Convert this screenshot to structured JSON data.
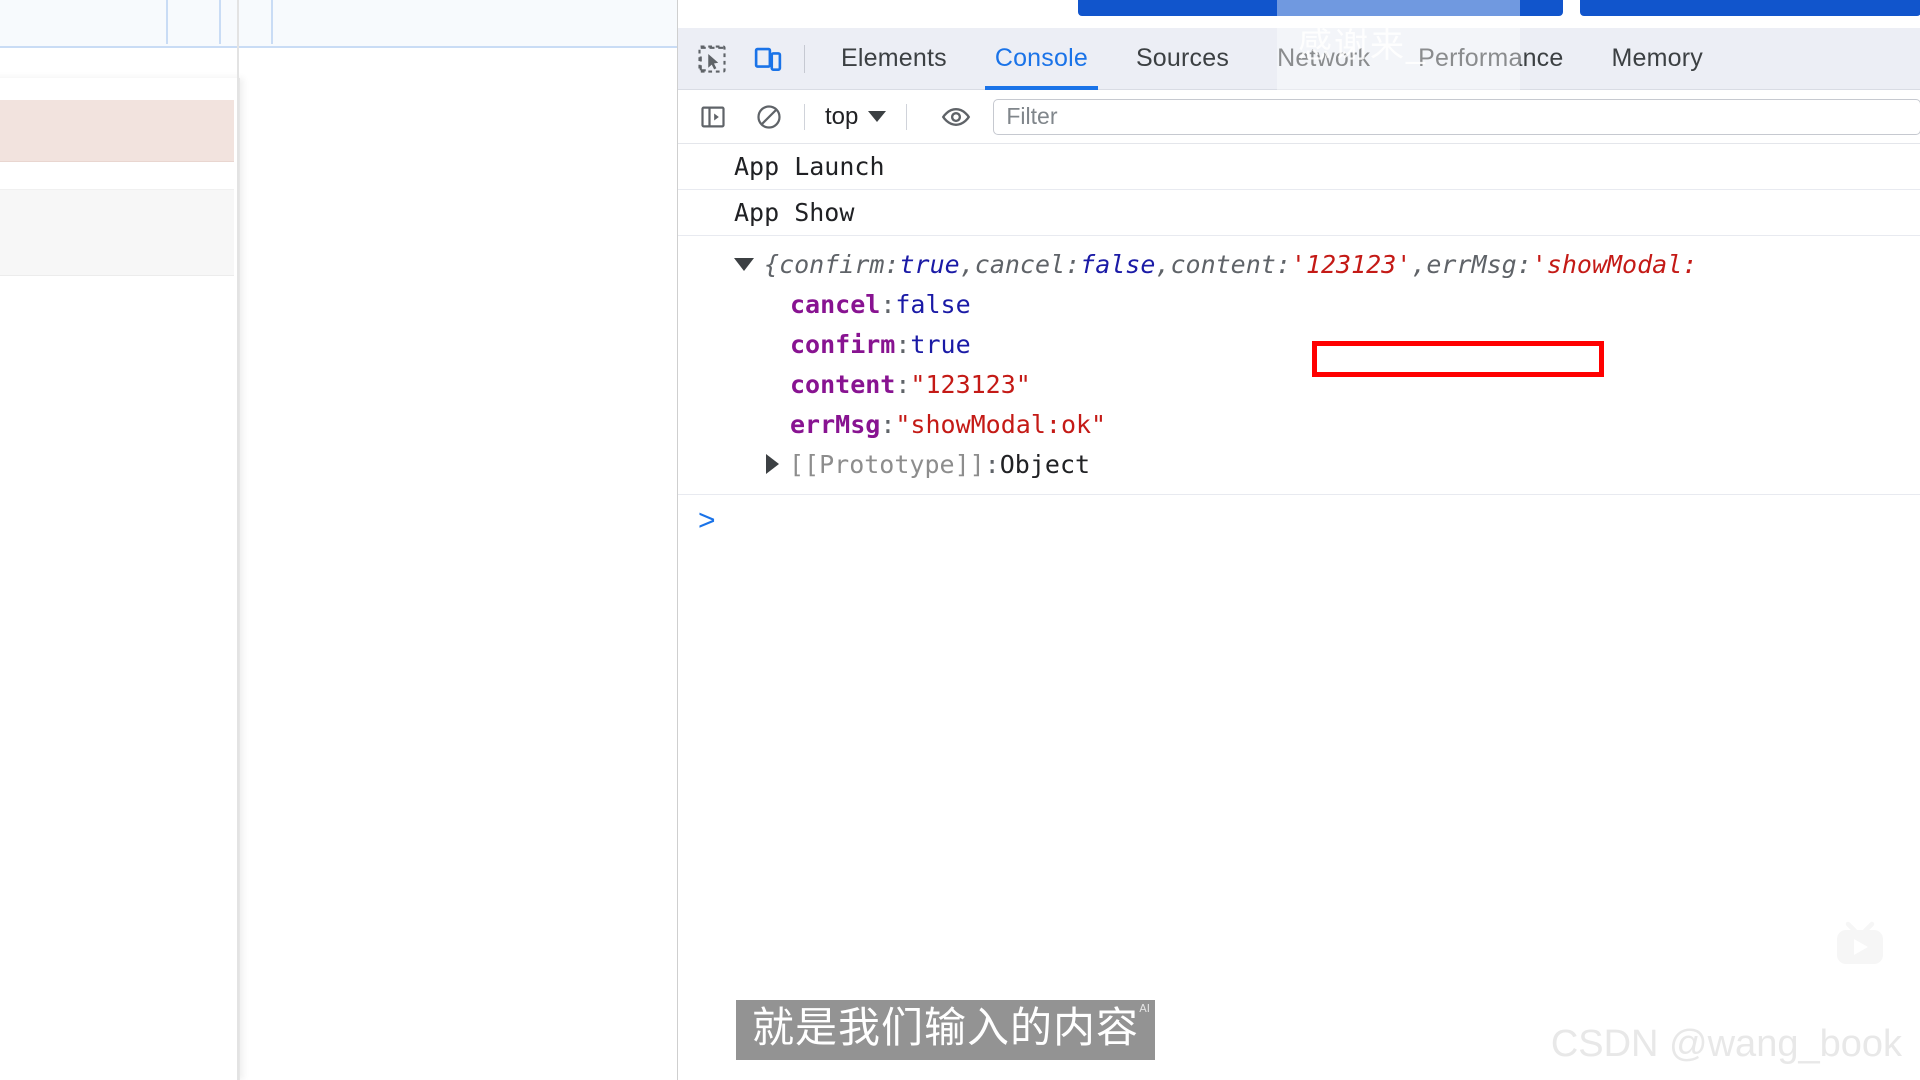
{
  "devtools": {
    "toolbar_icons": [
      {
        "name": "inspect-element-icon",
        "label": "Inspect element"
      },
      {
        "name": "device-toolbar-icon",
        "label": "Toggle device toolbar"
      }
    ],
    "tabs": [
      {
        "label": "Elements",
        "selected": false
      },
      {
        "label": "Console",
        "selected": true
      },
      {
        "label": "Sources",
        "selected": false
      },
      {
        "label": "Network",
        "selected": false
      },
      {
        "label": "Performance",
        "selected": false
      },
      {
        "label": "Memory",
        "selected": false
      }
    ],
    "console_toolbar": {
      "sidebar_toggle_label": "Show console sidebar",
      "clear_label": "Clear console",
      "context_value": "top",
      "eye_label": "Create live expression",
      "filter_placeholder": "Filter"
    },
    "accent_color": "#1a73e8",
    "tabbar_background": "#eceef5"
  },
  "console": {
    "messages": [
      {
        "type": "log",
        "text": "App Launch"
      },
      {
        "type": "log",
        "text": "App Show"
      }
    ],
    "object_log": {
      "expanded": true,
      "preview": {
        "open_brace": "{",
        "close_brace": "",
        "entries": [
          {
            "key": "confirm",
            "sep": ": ",
            "value": "true",
            "kind": "bool"
          },
          {
            "key": "cancel",
            "sep": ": ",
            "value": "false",
            "kind": "bool"
          },
          {
            "key": "content",
            "sep": ": ",
            "value": "'123123'",
            "kind": "string"
          },
          {
            "key": "errMsg",
            "sep": ": ",
            "value": "'showModal:",
            "kind": "string"
          }
        ],
        "separator": ", "
      },
      "properties": [
        {
          "key": "cancel",
          "sep": ": ",
          "value": "false",
          "kind": "bool"
        },
        {
          "key": "confirm",
          "sep": ": ",
          "value": "true",
          "kind": "bool"
        },
        {
          "key": "content",
          "sep": ": ",
          "value": "\"123123\"",
          "kind": "string",
          "highlighted": true
        },
        {
          "key": "errMsg",
          "sep": ": ",
          "value": "\"showModal:ok\"",
          "kind": "string"
        }
      ],
      "prototype": {
        "key": "[[Prototype]]",
        "sep": ": ",
        "value": "Object",
        "expanded": false
      }
    },
    "prompt_symbol": ">"
  },
  "annotation": {
    "highlight_color": "#ff0000",
    "target": "content: \"123123\""
  },
  "overlays": {
    "tab_watermark": "感谢来_",
    "subtitle_text": "就是我们输入的内容",
    "subtitle_ai_mark": "AI",
    "csdn_watermark": "CSDN @wang_book",
    "video_logo_name": "bilibili-tv-logo"
  }
}
